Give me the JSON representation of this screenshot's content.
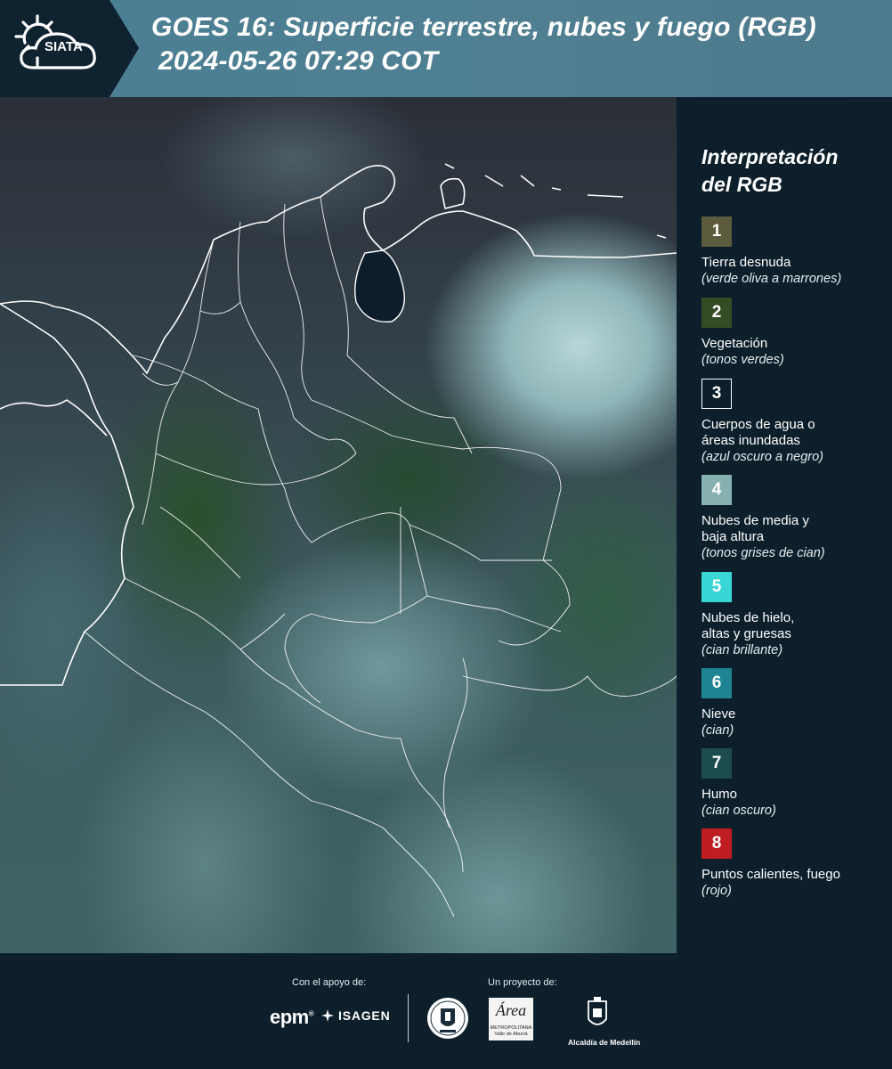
{
  "header": {
    "logo_text": "SIATA",
    "title_line1": "GOES 16: Superficie terrestre, nubes y fuego (RGB)",
    "title_line2": "2024-05-26 07:29 COT"
  },
  "legend": {
    "title_line1": "Interpretación",
    "title_line2": "del RGB",
    "items": [
      {
        "number": "1",
        "color": "#5c5b3c",
        "label_lines": [
          "Tierra desnuda"
        ],
        "desc": "(verde oliva a marrones)"
      },
      {
        "number": "2",
        "color": "#344b25",
        "label_lines": [
          "Vegetación"
        ],
        "desc": "(tonos verdes)"
      },
      {
        "number": "3",
        "color": "#0c1f2b",
        "label_lines": [
          "Cuerpos de agua o",
          "áreas inundadas"
        ],
        "desc": "(azul oscuro a negro)"
      },
      {
        "number": "4",
        "color": "#87b1b0",
        "label_lines": [
          "Nubes de media y",
          "baja altura"
        ],
        "desc": "(tonos grises de cian)"
      },
      {
        "number": "5",
        "color": "#3ad6d6",
        "label_lines": [
          "Nubes de hielo,",
          "altas y gruesas"
        ],
        "desc": "(cian brillante)"
      },
      {
        "number": "6",
        "color": "#1e8493",
        "label_lines": [
          "Nieve"
        ],
        "desc": "(cian)"
      },
      {
        "number": "7",
        "color": "#1d4c50",
        "label_lines": [
          "Humo"
        ],
        "desc": "(cian oscuro)"
      },
      {
        "number": "8",
        "color": "#c01d22",
        "label_lines": [
          "Puntos calientes, fuego"
        ],
        "desc": "(rojo)"
      }
    ]
  },
  "footer": {
    "support_label": "Con el apoyo de:",
    "project_label": "Un proyecto de:",
    "sponsor_epm": "epm",
    "sponsor_isagen": "ISAGEN",
    "area_logo_text": "Área",
    "area_logo_sub1": "METROPOLITANA",
    "area_logo_sub2": "Valle de Aburrá",
    "medellin_text": "Alcaldía de Medellín"
  }
}
